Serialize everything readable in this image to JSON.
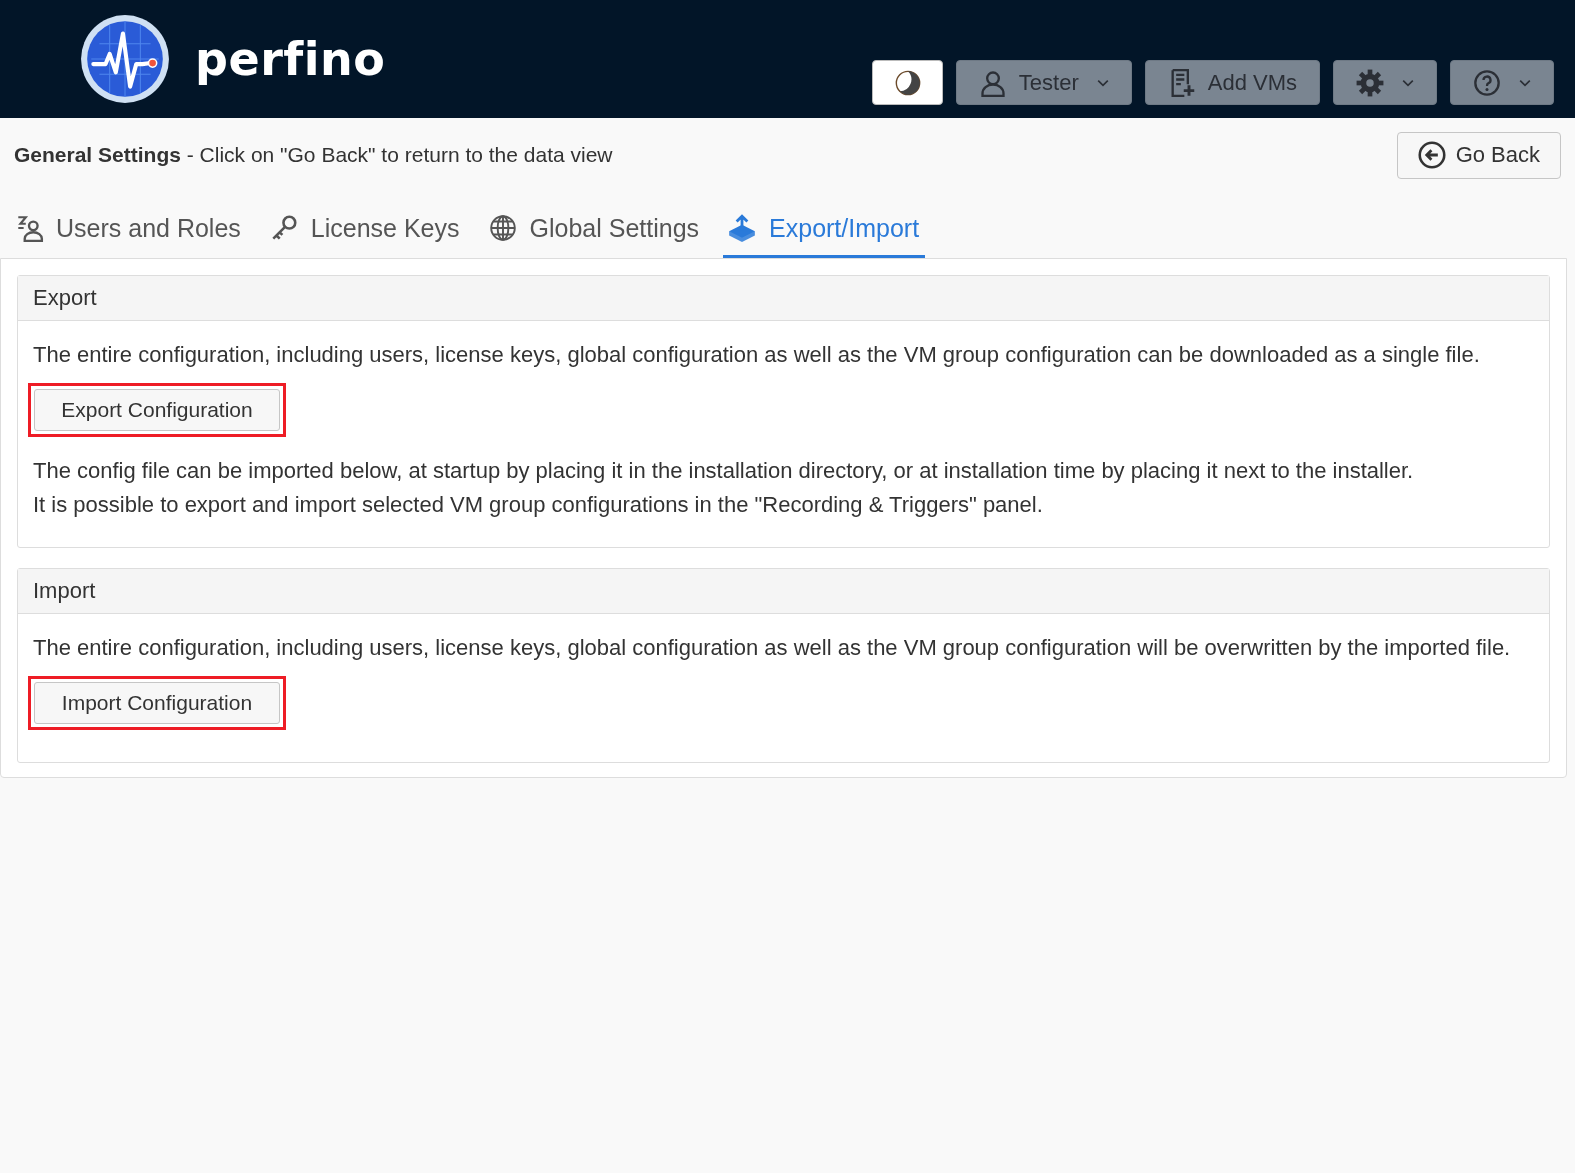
{
  "header": {
    "brand": "perfino",
    "buttons": [
      {
        "kind": "theme",
        "active": true,
        "dropdown": false
      },
      {
        "kind": "user",
        "label": "Tester",
        "active": false,
        "dropdown": true
      },
      {
        "kind": "add-vms",
        "label": "Add VMs",
        "active": false,
        "dropdown": false
      },
      {
        "kind": "settings",
        "active": false,
        "dropdown": true
      },
      {
        "kind": "help",
        "active": false,
        "dropdown": true
      }
    ]
  },
  "subheader": {
    "title": "General Settings",
    "hint": " - Click on \"Go Back\" to return to the data view",
    "go_back": "Go Back"
  },
  "tabs": [
    {
      "kind": "users",
      "label": "Users and Roles",
      "selected": false
    },
    {
      "kind": "keys",
      "label": "License Keys",
      "selected": false
    },
    {
      "kind": "global",
      "label": "Global Settings",
      "selected": false
    },
    {
      "kind": "export",
      "label": "Export/Import",
      "selected": true
    }
  ],
  "panels": [
    {
      "title": "Export",
      "blocks": [
        {
          "kind": "text",
          "text": "The entire configuration, including users, license keys, global configuration as well as the VM group configuration can be downloaded as a single file."
        },
        {
          "kind": "button",
          "label": "Export Configuration",
          "highlighted": true
        },
        {
          "kind": "text",
          "text": "The config file can be imported below, at startup by placing it in the installation directory, or at installation time by placing it next to the installer."
        },
        {
          "kind": "line",
          "text": "It is possible to export and import selected VM group configurations in the \"Recording & Triggers\" panel."
        }
      ]
    },
    {
      "title": "Import",
      "blocks": [
        {
          "kind": "text",
          "text": "The entire configuration, including users, license keys, global configuration as well as the VM group configuration will be overwritten by the imported file."
        },
        {
          "kind": "button",
          "label": "Import Configuration",
          "highlighted": true
        }
      ]
    }
  ]
}
